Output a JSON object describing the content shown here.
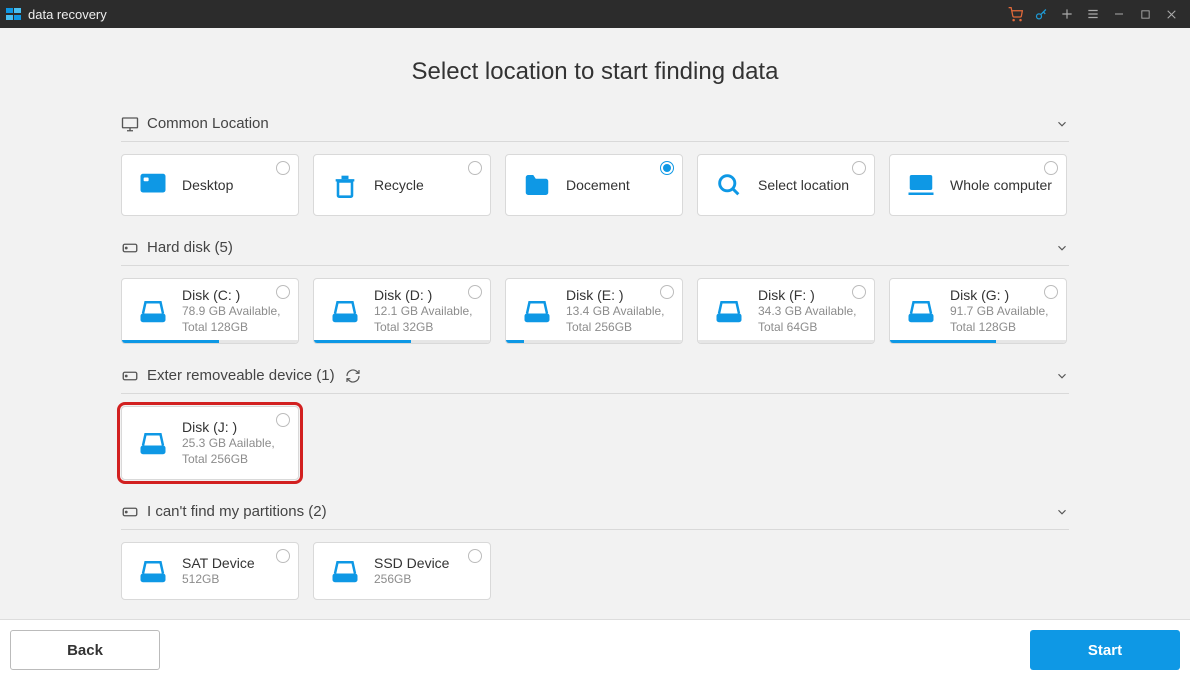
{
  "titlebar": {
    "title": "data recovery"
  },
  "heading": "Select location to  start finding data",
  "sections": {
    "common": {
      "label": "Common Location"
    },
    "hdd": {
      "label": "Hard disk (5)"
    },
    "external": {
      "label": "Exter removeable device (1)"
    },
    "lost": {
      "label": "I can't find my partitions (2)"
    }
  },
  "common": [
    {
      "label": "Desktop"
    },
    {
      "label": "Recycle"
    },
    {
      "label": "Docement"
    },
    {
      "label": "Select location"
    },
    {
      "label": "Whole computer"
    }
  ],
  "disks": [
    {
      "title": "Disk (C: )",
      "sub": "78.9 GB Available, Total 128GB",
      "usage_pct": 55
    },
    {
      "title": "Disk (D: )",
      "sub": "12.1 GB Available, Total 32GB",
      "usage_pct": 55
    },
    {
      "title": "Disk (E: )",
      "sub": "13.4 GB Available, Total 256GB",
      "usage_pct": 10
    },
    {
      "title": "Disk (F: )",
      "sub": "34.3 GB Available, Total 64GB",
      "usage_pct": 0
    },
    {
      "title": "Disk (G: )",
      "sub": "91.7 GB Available, Total 128GB",
      "usage_pct": 60
    }
  ],
  "external": [
    {
      "title": "Disk (J: )",
      "sub": "25.3 GB Aailable, Total 256GB"
    }
  ],
  "devices": [
    {
      "title": "SAT Device",
      "sub": "512GB"
    },
    {
      "title": "SSD Device",
      "sub": "256GB"
    }
  ],
  "footer": {
    "back": "Back",
    "start": "Start"
  },
  "colors": {
    "accent": "#0e98e5"
  }
}
